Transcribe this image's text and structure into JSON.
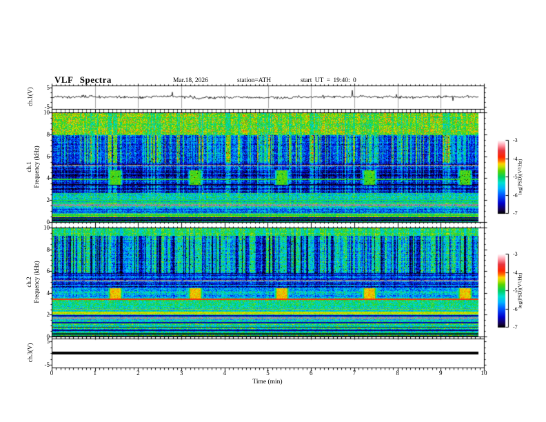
{
  "header": {
    "title": "VLF Spectra",
    "date": "Mar.18, 2026",
    "station": "station=ATH",
    "start_ut": "start UT =  19:40: 0"
  },
  "axes": {
    "time": {
      "label": "Time (min)",
      "tick_labels": [
        "0",
        "1",
        "2",
        "3",
        "4",
        "5",
        "6",
        "7",
        "8",
        "9",
        "10"
      ],
      "minor_step_min": 0.1
    },
    "freq": {
      "tick_labels": [
        "10",
        "8",
        "6",
        "4",
        "2",
        "0"
      ],
      "unit": "kHz"
    },
    "volts": {
      "tick_labels": [
        "5",
        "-5"
      ],
      "unit": "V"
    }
  },
  "colorbar": {
    "label": "log(PSD)(V²/Hz)",
    "tick_labels": [
      "-3",
      "-4",
      "-5",
      "-6",
      "-7"
    ],
    "stops": [
      {
        "pos": 0.0,
        "color": "#000000"
      },
      {
        "pos": 0.05,
        "color": "#140050"
      },
      {
        "pos": 0.14,
        "color": "#0000cd"
      },
      {
        "pos": 0.25,
        "color": "#0055ff"
      },
      {
        "pos": 0.34,
        "color": "#00b4ff"
      },
      {
        "pos": 0.42,
        "color": "#00e0d0"
      },
      {
        "pos": 0.5,
        "color": "#00d060"
      },
      {
        "pos": 0.58,
        "color": "#55d500"
      },
      {
        "pos": 0.64,
        "color": "#c8e000"
      },
      {
        "pos": 0.68,
        "color": "#ffd000"
      },
      {
        "pos": 0.72,
        "color": "#ff7000"
      },
      {
        "pos": 0.77,
        "color": "#ff2500"
      },
      {
        "pos": 0.86,
        "color": "#e83540"
      },
      {
        "pos": 0.93,
        "color": "#ff9aa8"
      },
      {
        "pos": 1.0,
        "color": "#ffffff"
      }
    ]
  },
  "panels": {
    "ch1_wave": {
      "ylabel": "ch.1(V)"
    },
    "ch1_spec": {
      "channel": "ch.1",
      "axis": "Frequency (kHz)"
    },
    "ch2_spec": {
      "channel": "ch.2",
      "axis": "Frequency (kHz)"
    },
    "ch3_wave": {
      "ylabel": "ch.3(V)"
    }
  },
  "chart_data": {
    "type": "heatmap",
    "title": "VLF Spectra",
    "date": "Mar.18, 2026",
    "station": "ATH",
    "start_ut": "19:40:0",
    "xlabel": "Time (min)",
    "x_range": [
      0,
      10
    ],
    "data_duration_min": 9.87,
    "z_label": "log(PSD)(V²/Hz)",
    "z_range": [
      -7,
      -3
    ],
    "panels": [
      {
        "id": "ch1_wave",
        "kind": "waveform",
        "ylabel": "ch.1(V)",
        "y_range": [
          -5,
          5
        ],
        "description": "broadband noise ~±1 V with sparse spikes to ±4 V",
        "noise_v": 0.62,
        "spike_prob": 0.02,
        "grid_minutes": true,
        "seed": 91
      },
      {
        "id": "ch1_spec",
        "kind": "spectrogram",
        "y_range": [
          0,
          10
        ],
        "seed": 11,
        "bands": [
          {
            "f": [
              8.0,
              10.0
            ],
            "base": -4.55,
            "noise": 0.45,
            "streak": -0.55,
            "row": 0.2,
            "red_speckle": 0.012
          },
          {
            "f": [
              5.45,
              8.0
            ],
            "base": -6.3,
            "noise": 0.5,
            "streak": 1.8,
            "row": 0.25,
            "speckle": 0.02
          },
          {
            "f": [
              2.7,
              5.45
            ],
            "base": -6.6,
            "noise": 0.45,
            "streak": 1.0,
            "row": 0.5,
            "speckle": 0.03
          },
          {
            "f": [
              2.05,
              2.7
            ],
            "base": -5.35,
            "noise": 0.55,
            "streak": 0.3,
            "row": 0.3
          },
          {
            "f": [
              1.35,
              2.05
            ],
            "base": -5.6,
            "noise": 0.5,
            "streak": 0.3,
            "row": 0.6
          },
          {
            "f": [
              0.85,
              1.35
            ],
            "base": -5.9,
            "noise": 0.55,
            "streak": 0.4,
            "row": 0.5
          },
          {
            "f": [
              0.5,
              0.85
            ],
            "base": -5.1,
            "noise": 0.4,
            "streak": 0.2,
            "row": 0.5
          },
          {
            "f": [
              0.12,
              0.5
            ],
            "base": -6.85,
            "noise": 0.25,
            "streak": 0.1,
            "row": 0.3
          },
          {
            "f": [
              0.0,
              0.12
            ],
            "base": -5.1,
            "noise": 0.3,
            "streak": 0.0,
            "row": 0.2
          }
        ],
        "lines": [
          {
            "f": 5.2,
            "hw": 0.07,
            "gray": true
          },
          {
            "f": 3.95,
            "hw": 0.05,
            "value": -4.85
          },
          {
            "f": 3.45,
            "hw": 0.04,
            "value": -6.9
          },
          {
            "f": 2.0,
            "hw": 0.05,
            "value": -4.9
          },
          {
            "f": 1.82,
            "hw": 0.04,
            "value": -5.0
          },
          {
            "f": 1.6,
            "hw": 0.1,
            "gray": true
          },
          {
            "f": 0.68,
            "hw": 0.05,
            "value": -4.9
          },
          {
            "f": 0.33,
            "hw": 0.04,
            "value": -5.0
          }
        ],
        "blobs": {
          "times": [
            1.45,
            3.3,
            5.3,
            7.33,
            9.54
          ],
          "t_hw": 0.17,
          "f": [
            3.45,
            4.75
          ],
          "value": -4.75
        }
      },
      {
        "id": "ch2_spec",
        "kind": "spectrogram",
        "y_range": [
          0,
          10
        ],
        "seed": 37,
        "bands": [
          {
            "f": [
              9.35,
              10.0
            ],
            "base": -4.8,
            "noise": 0.4,
            "streak": -0.6,
            "row": 0.2
          },
          {
            "f": [
              5.9,
              9.35
            ],
            "base": -5.05,
            "noise": 0.5,
            "streak": -1.9,
            "row": 0.25,
            "speckle": 0.015
          },
          {
            "f": [
              5.35,
              5.9
            ],
            "base": -6.1,
            "noise": 0.5,
            "streak": -0.5,
            "row": 0.6
          },
          {
            "f": [
              4.55,
              5.35
            ],
            "base": -5.95,
            "noise": 0.5,
            "streak": -0.4,
            "row": 0.5
          },
          {
            "f": [
              3.5,
              4.55
            ],
            "base": -5.45,
            "noise": 0.5,
            "streak": -0.3,
            "row": 0.4
          },
          {
            "f": [
              2.3,
              3.5
            ],
            "base": -5.05,
            "noise": 0.45,
            "streak": -0.2,
            "row": 0.35
          },
          {
            "f": [
              1.05,
              2.3
            ],
            "base": -5.15,
            "noise": 0.45,
            "streak": -0.2,
            "row": 0.45
          },
          {
            "f": [
              0.4,
              1.05
            ],
            "base": -5.3,
            "noise": 0.5,
            "streak": -0.2,
            "row": 0.55
          },
          {
            "f": [
              0.08,
              0.4
            ],
            "base": -5.0,
            "noise": 0.4,
            "streak": -0.1,
            "row": 0.4
          },
          {
            "f": [
              0.0,
              0.08
            ],
            "base": -6.8,
            "noise": 0.2,
            "streak": 0.0,
            "row": 0.2
          }
        ],
        "lines": [
          {
            "f": 5.2,
            "hw": 0.06,
            "gray": true
          },
          {
            "f": 3.45,
            "hw": 0.07,
            "value": -3.85
          },
          {
            "f": 2.55,
            "hw": 0.04,
            "value": -4.6
          },
          {
            "f": 2.2,
            "hw": 0.12,
            "value": -4.45
          },
          {
            "f": 1.95,
            "hw": 0.04,
            "value": -6.6
          },
          {
            "f": 1.72,
            "hw": 0.08,
            "gray": true
          },
          {
            "f": 1.3,
            "hw": 0.04,
            "value": -6.5
          },
          {
            "f": 0.9,
            "hw": 0.04,
            "value": -6.6
          },
          {
            "f": 0.6,
            "hw": 0.04,
            "value": -6.7
          },
          {
            "f": 0.3,
            "hw": 0.03,
            "value": -7.0
          },
          {
            "f": 0.18,
            "hw": 0.03,
            "value": -7.0
          }
        ],
        "blobs": {
          "times": [
            1.45,
            3.3,
            5.3,
            7.33,
            9.54
          ],
          "t_hw": 0.17,
          "f": [
            3.55,
            4.5
          ],
          "value": -4.3
        }
      },
      {
        "id": "ch3_wave",
        "kind": "flatline",
        "ylabel": "ch.3(V)",
        "y_range": [
          -5,
          5
        ],
        "value": 0,
        "description": "constant 0 V thick black line"
      }
    ]
  }
}
